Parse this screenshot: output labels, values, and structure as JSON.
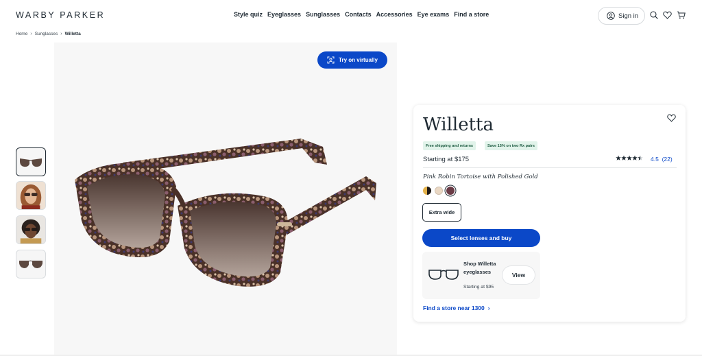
{
  "header": {
    "logo": "WARBY PARKER",
    "nav": [
      "Style quiz",
      "Eyeglasses",
      "Sunglasses",
      "Contacts",
      "Accessories",
      "Eye exams",
      "Find a store"
    ],
    "signin_label": "Sign in",
    "icons": [
      "search-icon",
      "heart-icon",
      "cart-icon"
    ]
  },
  "breadcrumb": [
    "Home",
    "Sunglasses",
    "Willetta"
  ],
  "gallery": {
    "try_on_label": "Try on virtually",
    "thumbnails": [
      "thumbnail-front",
      "thumbnail-model-1",
      "thumbnail-model-2",
      "thumbnail-angle"
    ]
  },
  "product": {
    "name": "Willetta",
    "badges": [
      "Free shipping and returns",
      "Save 15% on two Rx pairs"
    ],
    "price": "Starting at $175",
    "rating": "4.5",
    "reviews": "(22)",
    "stars": 4.5,
    "color_name": "Pink Robin Tortoise with Polished Gold",
    "swatches": [
      "#2b2b2b",
      "#e8d6c1",
      "#6a3b46"
    ],
    "width_label": "Extra wide",
    "cta_label": "Select lenses and buy",
    "eyeglasses": {
      "title": "Shop Willetta eyeglasses",
      "subtitle": "Starting at $95",
      "button": "View"
    },
    "store_link": "Find a store near 1300"
  },
  "colors": {
    "brand_blue": "#0b48c8",
    "text": "#1f2a33",
    "badge_bg": "#e1f3ea"
  }
}
